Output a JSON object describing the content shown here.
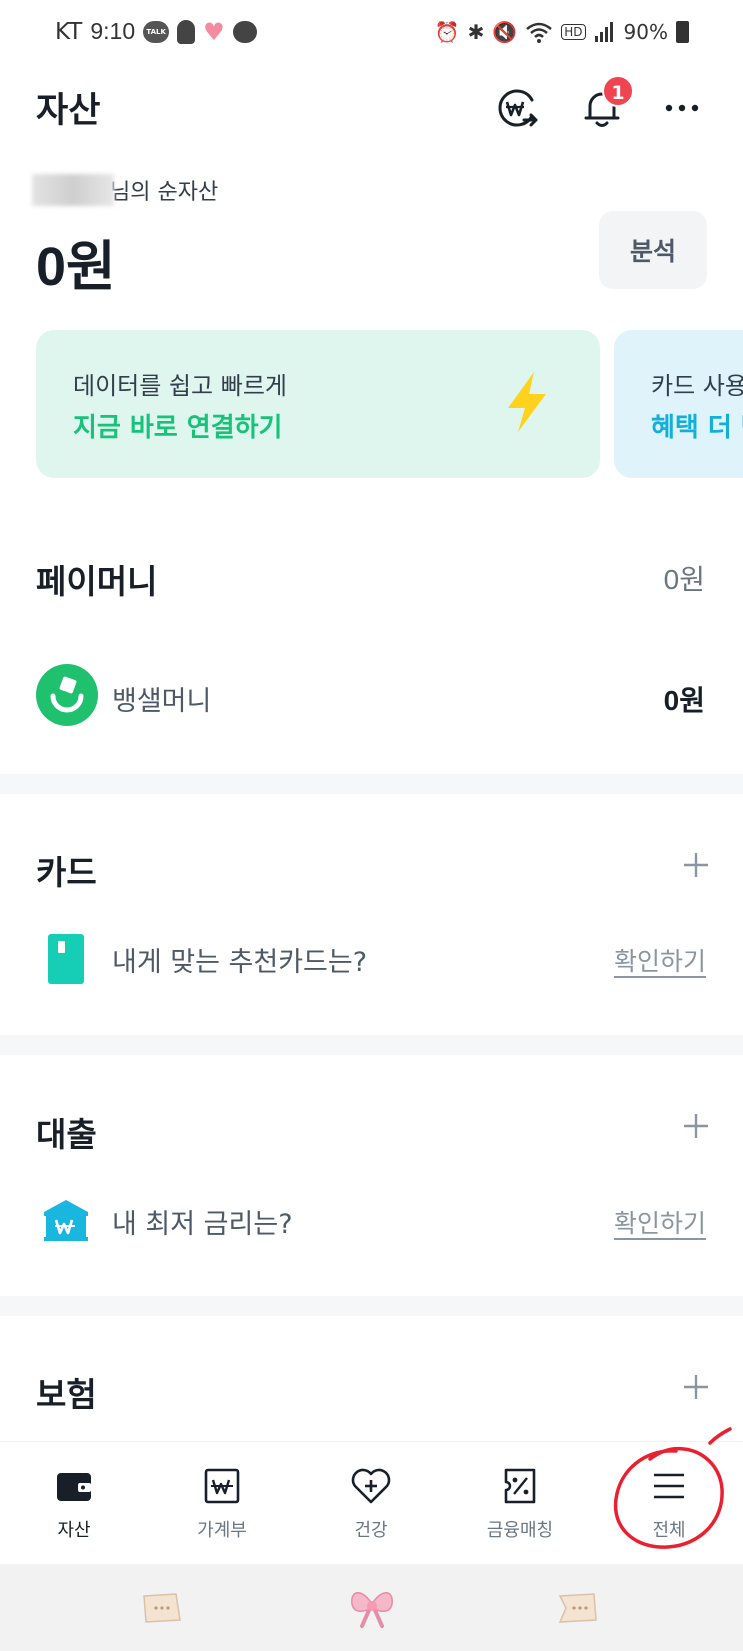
{
  "status_bar": {
    "carrier": "KT",
    "time": "9:10",
    "talk_label": "TALK",
    "battery": "90%",
    "hd_label": "HD"
  },
  "header": {
    "title": "자산",
    "notification_count": "1"
  },
  "net_assets": {
    "label": "님의 순자산",
    "amount": "0원",
    "analyze_button": "분석"
  },
  "banners": [
    {
      "sub": "데이터를 쉽고 빠르게",
      "main": "지금 바로 연결하기"
    },
    {
      "sub": "카드 사용",
      "main": "혜택 더 받"
    }
  ],
  "paymoney": {
    "title": "페이머니",
    "total": "0원",
    "items": [
      {
        "label": "뱅샐머니",
        "value": "0원"
      }
    ]
  },
  "card": {
    "title": "카드",
    "row_label": "내게 맞는 추천카드는?",
    "row_link": "확인하기"
  },
  "loan": {
    "title": "대출",
    "row_label": "내 최저 금리는?",
    "row_link": "확인하기"
  },
  "insurance": {
    "title": "보험"
  },
  "bottom_nav": [
    {
      "label": "자산",
      "icon": "wallet-icon",
      "active": true
    },
    {
      "label": "가계부",
      "icon": "ledger-icon",
      "active": false
    },
    {
      "label": "건강",
      "icon": "heart-plus-icon",
      "active": false
    },
    {
      "label": "금융매칭",
      "icon": "coupon-percent-icon",
      "active": false
    },
    {
      "label": "전체",
      "icon": "menu-icon",
      "active": false
    }
  ],
  "colors": {
    "accent_green": "#17c27a",
    "accent_blue": "#12b0d9",
    "badge_red": "#f04452",
    "banner1_bg": "#def6ee",
    "banner2_bg": "#def3fa",
    "annotation_red": "#e8202f"
  }
}
